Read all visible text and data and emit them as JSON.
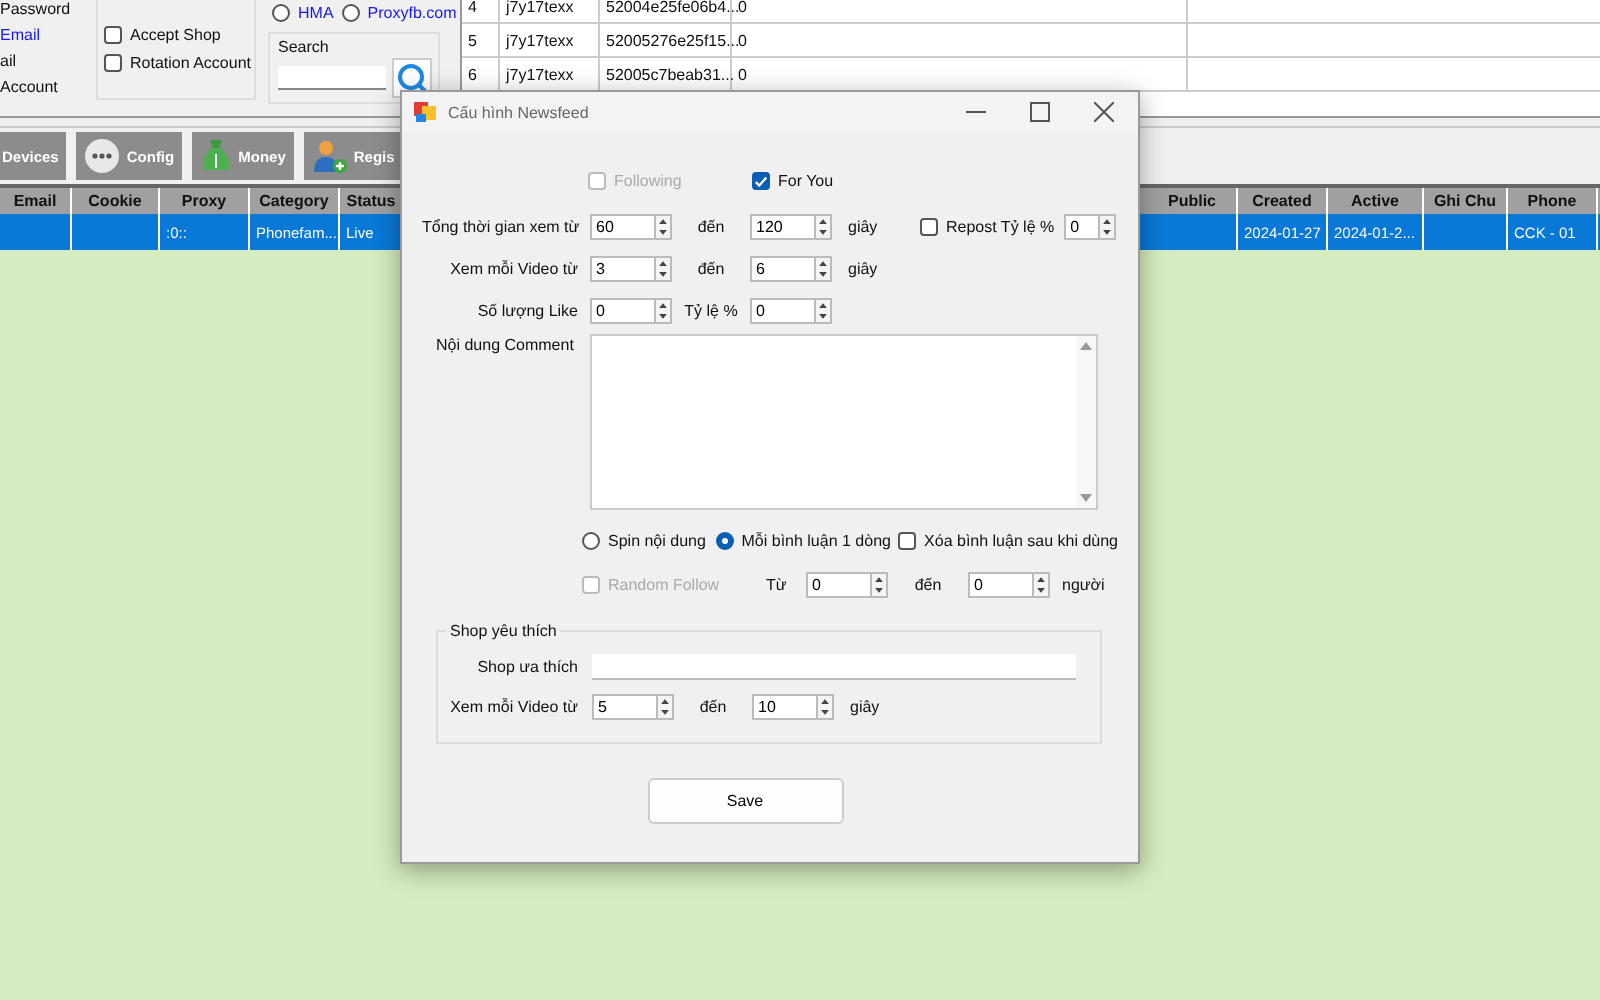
{
  "app": {
    "left_labels": [
      {
        "text": "Password",
        "kind": "plain"
      },
      {
        "text": "Email",
        "kind": "link"
      },
      {
        "text": "ail",
        "kind": "plain"
      },
      {
        "text": "Account",
        "kind": "plain"
      }
    ],
    "options": [
      {
        "label": "Accept Shop",
        "checked": false
      },
      {
        "label": "Rotation Account",
        "checked": false
      }
    ],
    "proxy_radios": [
      {
        "label": "HMA",
        "selected": false
      },
      {
        "label": "Proxyfb.com",
        "selected": false
      }
    ],
    "search": {
      "label": "Search"
    },
    "top_table": {
      "rows": [
        [
          "4",
          "j7y17texx",
          "52004e25fe06b4...",
          "0"
        ],
        [
          "5",
          "j7y17texx",
          "52005276e25f15...",
          "0"
        ],
        [
          "6",
          "j7y17texx",
          "52005c7beab31...",
          "0"
        ]
      ]
    },
    "toolbar": [
      {
        "label": "Devices"
      },
      {
        "label": "Config"
      },
      {
        "label": "Money"
      },
      {
        "label": "Regis"
      }
    ],
    "table": {
      "columns": [
        "Email",
        "Cookie",
        "Proxy",
        "Category",
        "Status",
        "Public",
        "Created",
        "Active",
        "Ghi Chu",
        "Phone"
      ],
      "rows": [
        {
          "selected": true,
          "cells": [
            null,
            null,
            ":0::",
            "Phonefam...",
            "Live",
            null,
            "2024-01-27",
            "2024-01-2...",
            null,
            "CCK - 01"
          ]
        }
      ]
    }
  },
  "dialog": {
    "title": "Cấu hình Newsfeed",
    "feeds": [
      {
        "label": "Following",
        "checked": false,
        "disabled": true
      },
      {
        "label": "For You",
        "checked": true,
        "disabled": false
      }
    ],
    "total_time": {
      "label": "Tổng  thời gian xem từ",
      "from": "60",
      "to_label": "đến",
      "to": "120",
      "unit": "giây"
    },
    "repost": {
      "label": "Repost Tỷ lệ %",
      "checked": false,
      "value": "0"
    },
    "video_time": {
      "label": "Xem mỗi Video từ",
      "from": "3",
      "to_label": "đến",
      "to": "6",
      "unit": "giây"
    },
    "likes": {
      "label": "Số lượng Like",
      "value": "0",
      "ratio_label": "Tỷ lệ %",
      "ratio": "0"
    },
    "comment": {
      "label": "Nội dung Comment"
    },
    "comment_modes": [
      {
        "label": "Spin nội dung",
        "selected": false
      },
      {
        "label": "Mỗi bình luận 1 dòng",
        "selected": true
      }
    ],
    "delete_after": {
      "label": "Xóa bình luận sau khi dùng",
      "checked": false
    },
    "random_follow": {
      "label": "Random Follow",
      "checked": false,
      "disabled": true,
      "from_label": "Từ",
      "from": "0",
      "to_label": "đến",
      "to": "0",
      "unit": "người"
    },
    "shop": {
      "title": "Shop yêu thích",
      "field_label": "Shop ưa thích",
      "video_label": "Xem mỗi Video từ",
      "from": "5",
      "to_label": "đến",
      "to": "10",
      "unit": "giây"
    },
    "save": "Save"
  }
}
